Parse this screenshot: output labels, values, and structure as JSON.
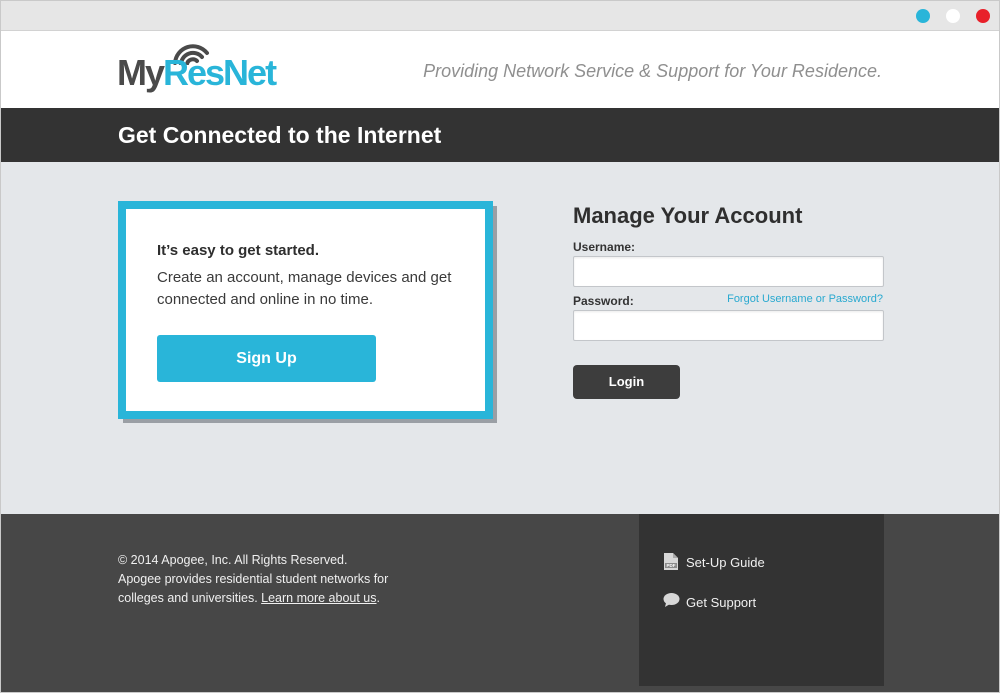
{
  "window": {
    "controls": [
      {
        "name": "blue",
        "color": "#29b5d9"
      },
      {
        "name": "white",
        "color": "#ffffff"
      },
      {
        "name": "red",
        "color": "#e8202a"
      }
    ]
  },
  "header": {
    "logo_text_my": "My",
    "logo_text_resnet": "ResNet",
    "tagline": "Providing Network Service & Support for Your Residence."
  },
  "banner": {
    "title": "Get Connected to the Internet"
  },
  "promo": {
    "title": "It’s easy to get started.",
    "description": "Create an account, manage devices and get connected and online in no time.",
    "signup_label": "Sign Up"
  },
  "account": {
    "title": "Manage Your Account",
    "username_label": "Username:",
    "username_value": "",
    "password_label": "Password:",
    "password_value": "",
    "forgot_label": "Forgot Username or Password?",
    "login_label": "Login"
  },
  "footer": {
    "copyright": "© 2014 Apogee, Inc. All Rights Reserved.",
    "about_text": "Apogee provides residential student networks for colleges and universities.",
    "learn_more_label": "Learn more about us",
    "about_suffix": ".",
    "links": [
      {
        "label": "Set-Up Guide",
        "icon": "pdf-icon"
      },
      {
        "label": "Get Support",
        "icon": "speech-bubble-icon"
      }
    ]
  },
  "colors": {
    "accent": "#29b5d9",
    "banner": "#333333",
    "footer": "#474747",
    "footer_side": "#333333",
    "page_bg": "#e4e7ea",
    "login_button": "#3d3d3d"
  }
}
